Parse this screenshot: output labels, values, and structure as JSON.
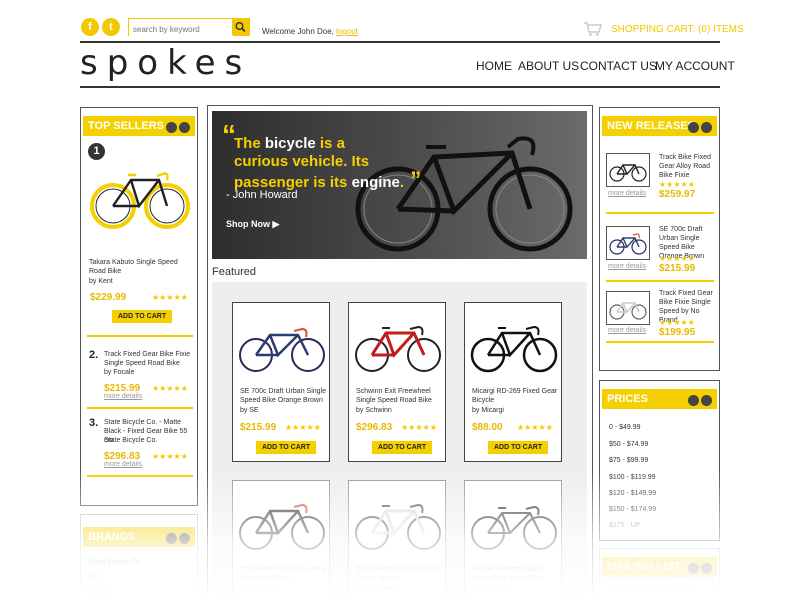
{
  "header": {
    "social": [
      {
        "icon": "facebook-icon",
        "glyph": "f"
      },
      {
        "icon": "twitter-icon",
        "glyph": "t"
      }
    ],
    "search_placeholder": "search by keyword",
    "welcome": "Welcome John Doe,",
    "logout": "logout",
    "cart": "SHOPPING CART: (0) ITEMS",
    "logo": "spokes"
  },
  "nav": [
    "HOME",
    "ABOUT US",
    "CONTACT US",
    "MY ACCOUNT"
  ],
  "hero": {
    "quote_line1_a": "The ",
    "quote_line1_b": "bicycle",
    "quote_line1_c": " is a",
    "quote_line2": "curious vehicle.  Its",
    "quote_line3_a": "passenger is its ",
    "quote_line3_b": "engine",
    "quote_line3_c": ".",
    "author": "- John Howard",
    "cta": "Shop Now"
  },
  "featured": {
    "title": "Featured",
    "products": [
      {
        "name": "SE 700c Draft Urban Single Speed Bike Orange Brown",
        "brand": "by SE",
        "price": "$215.99",
        "stars": "★★★★★",
        "cta": "ADD TO CART"
      },
      {
        "name": "Schwinn Exit Freewheel Single Speed Road Bike",
        "brand": "by Schwinn",
        "price": "$296.83",
        "stars": "★★★★★",
        "cta": "ADD TO CART"
      },
      {
        "name": "Micargi RD-269 Fixed Gear Bicycle",
        "brand": "by Micargi",
        "price": "$88.00",
        "stars": "★★★★★",
        "cta": "ADD TO CART"
      },
      {
        "name": "Track Bike Fixed Gear Alloy Road Bike Fixie",
        "brand": "by No Brand",
        "price": "",
        "stars": "",
        "cta": ""
      },
      {
        "name": "Track Fixed Gear Bike Fixie Single Speed",
        "brand": "by No Brand",
        "price": "",
        "stars": "",
        "cta": ""
      },
      {
        "name": "Focale 44 Matte Black Notes Fixie Track Bike",
        "brand": "by Focale 44",
        "price": "",
        "stars": "",
        "cta": ""
      }
    ]
  },
  "top_sellers": {
    "title": "TOP SELLERS",
    "first": {
      "rank": "1",
      "name": "Takara Kabuto Single Speed Road Bike",
      "brand": "by Kent",
      "price": "$229.99",
      "stars": "★★★★★",
      "cta": "ADD TO CART"
    },
    "items": [
      {
        "rank": "2.",
        "name": "Track Fixed Gear Bike Fixie Single Speed Road Bike",
        "brand": "by Focale",
        "price": "$215.99",
        "stars": "★★★★★",
        "more": "more details"
      },
      {
        "rank": "3.",
        "name": "State Bicycle Co. - Matte Black - Fixed Gear Bike 55 cm",
        "brand": "State Bicycle Co.",
        "price": "$296.83",
        "stars": "★★★★★",
        "more": "more details"
      }
    ]
  },
  "brands": {
    "title": "BRANDS",
    "items": [
      "State Bicycle Co",
      "SE",
      "Takara"
    ]
  },
  "new_releases": {
    "title": "NEW RELEASES",
    "items": [
      {
        "name": "Track Bike Fixed Gear Alloy Road Bike Fixie",
        "price": "$259.97",
        "stars": "★★★★★",
        "more": "more details"
      },
      {
        "name": "SE 700c Draft Urban Single Speed Bike Orange Brown",
        "price": "$215.99",
        "stars": "★★★★★",
        "more": "more details"
      },
      {
        "name": "Track Fixed  Gear Bike Fixie Single Speed by No Brand",
        "price": "$199.95",
        "stars": "★★★★★",
        "more": "more details"
      }
    ]
  },
  "prices": {
    "title": "PRICES",
    "items": [
      "0 - $49.99",
      "$50 - $74.99",
      "$75 - $99.99",
      "$100 - $119.99",
      "$120 - $149.99",
      "$150 - $174.99",
      "$175 - UP"
    ]
  },
  "mailing": {
    "title": "MAILING LIST",
    "text": "Subscribe to our mailing list"
  }
}
